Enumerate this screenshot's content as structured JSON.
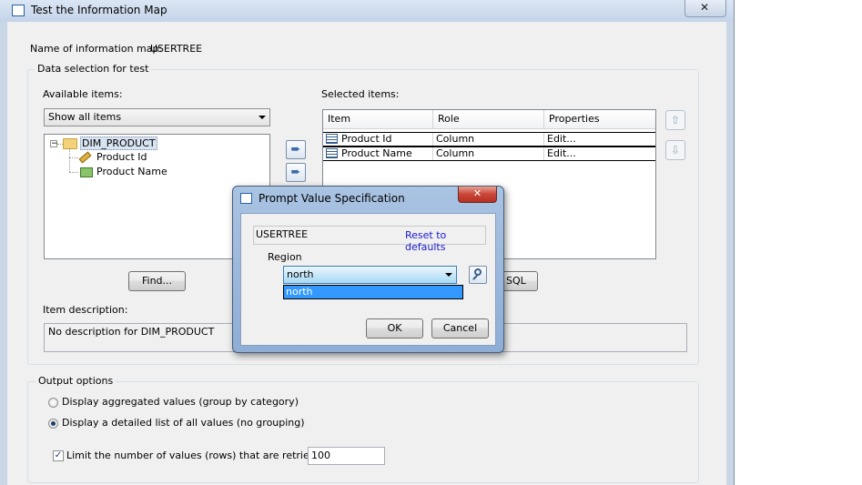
{
  "main_window": {
    "title": "Test the Information Map",
    "map_name_label": "Name of information map:",
    "map_name_value": "USERTREE",
    "data_selection_label": "Data selection for test",
    "available_items_label": "Available items:",
    "available_filter": "Show all items",
    "tree": {
      "root": "DIM_PRODUCT",
      "children": [
        "Product Id",
        "Product Name"
      ]
    },
    "selected_items_label": "Selected items:",
    "table": {
      "columns": [
        "Item",
        "Role",
        "Properties"
      ],
      "rows": [
        {
          "item": "Product Id",
          "role": "Column",
          "properties": "Edit..."
        },
        {
          "item": "Product Name",
          "role": "Column",
          "properties": "Edit..."
        }
      ]
    },
    "find_button": "Find...",
    "sql_button": "SQL",
    "item_description_label": "Item description:",
    "item_description_value": "No description for DIM_PRODUCT",
    "output_options_label": "Output options",
    "radio_aggregated": "Display aggregated values (group by category)",
    "radio_detailed": "Display a detailed list of all values (no grouping)",
    "limit_label": "Limit the number of values (rows) that are retrieved:",
    "limit_value": "100"
  },
  "prompt_dialog": {
    "title": "Prompt Value Specification",
    "header_name": "USERTREE",
    "reset_link": "Reset to defaults",
    "region_label": "Region",
    "region_selected": "north",
    "region_options": [
      "north"
    ],
    "ok_button": "OK",
    "cancel_button": "Cancel"
  }
}
